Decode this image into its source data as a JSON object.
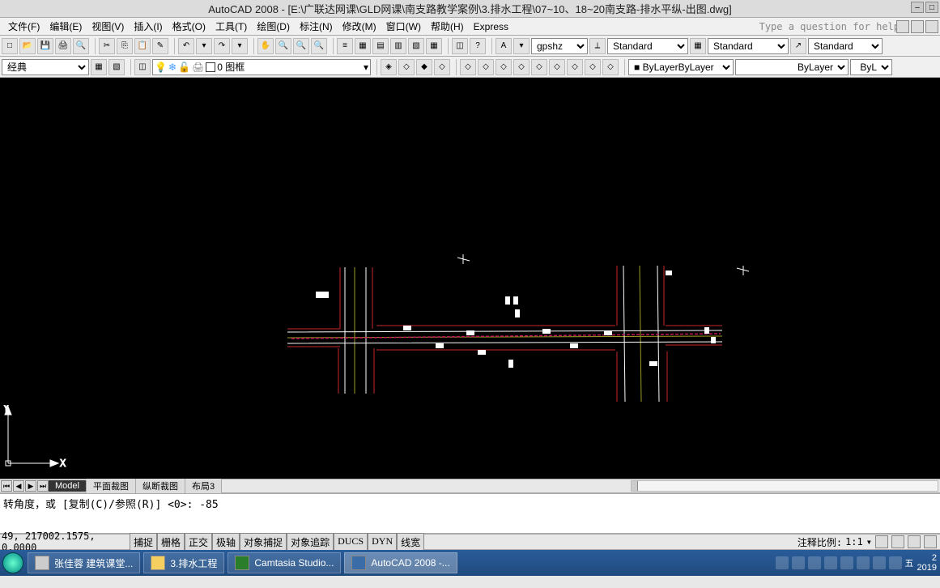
{
  "titlebar": {
    "title": "AutoCAD 2008 - [E:\\广联达网课\\GLD网课\\南支路教学案例\\3.排水工程\\07~10、18~20南支路-排水平纵-出图.dwg]"
  },
  "menubar": {
    "items": [
      "文件(F)",
      "编辑(E)",
      "视图(V)",
      "插入(I)",
      "格式(O)",
      "工具(T)",
      "绘图(D)",
      "标注(N)",
      "修改(M)",
      "窗口(W)",
      "帮助(H)",
      "Express"
    ],
    "help_prompt": "Type a question for help"
  },
  "toolbar1": {
    "textstyle": "gpshz",
    "dimstyle1": "Standard",
    "dimstyle2": "Standard",
    "dimstyle3": "Standard"
  },
  "toolbar2": {
    "visualstyle": "经典",
    "layer_current": "0 图框",
    "bylayer1": "ByLayer",
    "bylayer2": "ByLayer",
    "bylayer3": "ByL"
  },
  "tabs": {
    "items": [
      "Model",
      "平面裁图",
      "纵断裁图",
      "布局3"
    ],
    "active": 0
  },
  "command": {
    "line1": "转角度，或 [复制(C)/参照(R)] <0>:   -85",
    "line2": ""
  },
  "statusbar": {
    "coords": "49, 217002.1575, 0.0000",
    "modes": [
      "捕捉",
      "栅格",
      "正交",
      "极轴",
      "对象捕捉",
      "对象追踪",
      "DUCS",
      "DYN",
      "线宽"
    ],
    "annoscale_label": "注释比例:",
    "annoscale_value": "1:1"
  },
  "taskbar": {
    "items": [
      {
        "label": "张佳蓉 建筑课堂...",
        "active": false
      },
      {
        "label": "3.排水工程",
        "active": false
      },
      {
        "label": "Camtasia Studio...",
        "active": false
      },
      {
        "label": "AutoCAD 2008 -...",
        "active": true
      }
    ],
    "clock": {
      "time": "2",
      "date": "2019"
    }
  }
}
